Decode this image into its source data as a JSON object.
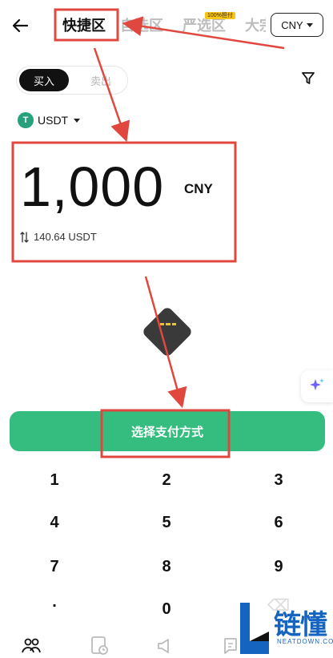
{
  "header": {
    "tabs": [
      {
        "label": "快捷区",
        "active": true
      },
      {
        "label": "自选区",
        "active": false
      },
      {
        "label": "严选区",
        "active": false
      },
      {
        "label": "大宗",
        "active": false
      }
    ],
    "badge": "100%担付",
    "currency": "CNY"
  },
  "trade": {
    "buy_label": "买入",
    "sell_label": "卖出"
  },
  "asset": {
    "symbol": "USDT",
    "coin_glyph": "T",
    "coin_color": "#26a17b"
  },
  "amount": {
    "value": "1,000",
    "unit": "CNY",
    "converted": "140.64 USDT"
  },
  "cta": {
    "label": "选择支付方式",
    "color": "#35bd80"
  },
  "keypad": {
    "keys": [
      "1",
      "2",
      "3",
      "4",
      "5",
      "6",
      "7",
      "8",
      "9",
      ".",
      "0",
      "⌫"
    ]
  },
  "bottom_nav": {
    "icons": [
      "users-icon",
      "order-clock-icon",
      "megaphone-icon",
      "chat-icon"
    ]
  },
  "watermark": {
    "chinese": "链懂",
    "english": "NEATDOWN.COM"
  },
  "annotation": {
    "color": "#e0483f"
  }
}
